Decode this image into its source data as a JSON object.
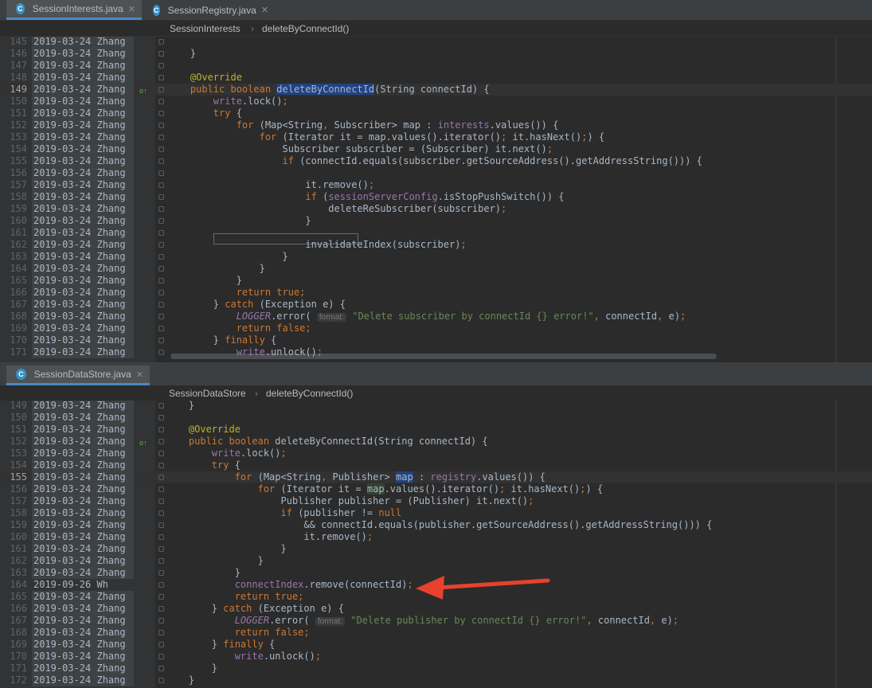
{
  "top": {
    "tabs": [
      {
        "label": "SessionInterests.java",
        "icon": "C",
        "active": true
      },
      {
        "label": "SessionRegistry.java",
        "icon": "C",
        "active": false
      }
    ],
    "breadcrumb": {
      "class": "SessionInterests",
      "method": "deleteByConnectId()"
    },
    "lines": [
      {
        "n": "145",
        "a": "2019-03-24 Zhang",
        "t": []
      },
      {
        "n": "146",
        "a": "2019-03-24 Zhang",
        "t": [
          [
            "    }",
            ""
          ]
        ]
      },
      {
        "n": "147",
        "a": "2019-03-24 Zhang",
        "t": []
      },
      {
        "n": "148",
        "a": "2019-03-24 Zhang",
        "t": [
          [
            "    ",
            ""
          ],
          [
            "@Override",
            "an"
          ]
        ]
      },
      {
        "n": "149",
        "a": "2019-03-24 Zhang",
        "cur": true,
        "t": [
          [
            "    ",
            ""
          ],
          [
            "public boolean ",
            "kw"
          ],
          [
            "deleteByConnectId",
            "sel"
          ],
          [
            "(String connectId) {",
            ""
          ]
        ]
      },
      {
        "n": "150",
        "a": "2019-03-24 Zhang",
        "t": [
          [
            "        ",
            ""
          ],
          [
            "write",
            "fd"
          ],
          [
            ".lock()",
            ""
          ],
          [
            ";",
            "kw"
          ]
        ]
      },
      {
        "n": "151",
        "a": "2019-03-24 Zhang",
        "t": [
          [
            "        ",
            ""
          ],
          [
            "try ",
            "kw"
          ],
          [
            "{",
            ""
          ]
        ]
      },
      {
        "n": "152",
        "a": "2019-03-24 Zhang",
        "t": [
          [
            "            ",
            ""
          ],
          [
            "for ",
            "kw"
          ],
          [
            "(Map<String",
            ""
          ],
          [
            ", ",
            "kw"
          ],
          [
            "Subscriber> map : ",
            ""
          ],
          [
            "interests",
            "fd"
          ],
          [
            ".values()) {",
            ""
          ]
        ]
      },
      {
        "n": "153",
        "a": "2019-03-24 Zhang",
        "t": [
          [
            "                ",
            ""
          ],
          [
            "for ",
            "kw"
          ],
          [
            "(Iterator it = map.values().iterator()",
            ""
          ],
          [
            "; ",
            "kw"
          ],
          [
            "it.hasNext()",
            ""
          ],
          [
            ";",
            "kw"
          ],
          [
            ") {",
            ""
          ]
        ]
      },
      {
        "n": "154",
        "a": "2019-03-24 Zhang",
        "t": [
          [
            "                    Subscriber subscriber = (Subscriber) it.next()",
            ""
          ],
          [
            ";",
            "kw"
          ]
        ]
      },
      {
        "n": "155",
        "a": "2019-03-24 Zhang",
        "t": [
          [
            "                    ",
            ""
          ],
          [
            "if ",
            "kw"
          ],
          [
            "(connectId.equals(subscriber.getSourceAddress().getAddressString())) {",
            ""
          ]
        ]
      },
      {
        "n": "156",
        "a": "2019-03-24 Zhang",
        "t": []
      },
      {
        "n": "157",
        "a": "2019-03-24 Zhang",
        "t": [
          [
            "                        it.remove()",
            ""
          ],
          [
            ";",
            "kw"
          ]
        ]
      },
      {
        "n": "158",
        "a": "2019-03-24 Zhang",
        "t": [
          [
            "                        ",
            ""
          ],
          [
            "if ",
            "kw"
          ],
          [
            "(",
            ""
          ],
          [
            "sessionServerConfig",
            "fd"
          ],
          [
            ".isStopPushSwitch()) {",
            ""
          ]
        ]
      },
      {
        "n": "159",
        "a": "2019-03-24 Zhang",
        "t": [
          [
            "                            deleteReSubscriber(subscriber)",
            ""
          ],
          [
            ";",
            "kw"
          ]
        ]
      },
      {
        "n": "160",
        "a": "2019-03-24 Zhang",
        "t": [
          [
            "                        }",
            ""
          ]
        ]
      },
      {
        "n": "161",
        "a": "2019-03-24 Zhang",
        "t": []
      },
      {
        "n": "162",
        "a": "2019-03-24 Zhang",
        "t": [
          [
            "                        invalidateIndex(subscriber)",
            ""
          ],
          [
            ";",
            "kw"
          ]
        ]
      },
      {
        "n": "163",
        "a": "2019-03-24 Zhang",
        "t": [
          [
            "                    }",
            ""
          ]
        ]
      },
      {
        "n": "164",
        "a": "2019-03-24 Zhang",
        "t": [
          [
            "                }",
            ""
          ]
        ]
      },
      {
        "n": "165",
        "a": "2019-03-24 Zhang",
        "t": [
          [
            "            }",
            ""
          ]
        ]
      },
      {
        "n": "166",
        "a": "2019-03-24 Zhang",
        "t": [
          [
            "            ",
            ""
          ],
          [
            "return true;",
            "kw"
          ]
        ]
      },
      {
        "n": "167",
        "a": "2019-03-24 Zhang",
        "t": [
          [
            "        } ",
            ""
          ],
          [
            "catch ",
            "kw"
          ],
          [
            "(Exception e) {",
            ""
          ]
        ]
      },
      {
        "n": "168",
        "a": "2019-03-24 Zhang",
        "t": [
          [
            "            ",
            ""
          ],
          [
            "LOGGER",
            "mut"
          ],
          [
            ".error( ",
            ""
          ],
          [
            "format:",
            "hint"
          ],
          [
            " ",
            ""
          ],
          [
            "\"Delete subscriber by connectId {} error!\"",
            "st"
          ],
          [
            ", ",
            "kw"
          ],
          [
            "connectId",
            ""
          ],
          [
            ", ",
            "kw"
          ],
          [
            "e)",
            ""
          ],
          [
            ";",
            "kw"
          ]
        ]
      },
      {
        "n": "169",
        "a": "2019-03-24 Zhang",
        "t": [
          [
            "            ",
            ""
          ],
          [
            "return false;",
            "kw"
          ]
        ]
      },
      {
        "n": "170",
        "a": "2019-03-24 Zhang",
        "t": [
          [
            "        } ",
            ""
          ],
          [
            "finally ",
            "kw"
          ],
          [
            "{",
            ""
          ]
        ]
      },
      {
        "n": "171",
        "a": "2019-03-24 Zhang",
        "t": [
          [
            "            ",
            ""
          ],
          [
            "write",
            "fd"
          ],
          [
            ".unlock()",
            ""
          ],
          [
            ";",
            "kw"
          ]
        ]
      }
    ]
  },
  "bottom": {
    "tabs": [
      {
        "label": "SessionDataStore.java",
        "icon": "C",
        "active": true
      }
    ],
    "breadcrumb": {
      "class": "SessionDataStore",
      "method": "deleteByConnectId()"
    },
    "lines": [
      {
        "n": "149",
        "a": "2019-03-24 Zhang",
        "t": [
          [
            "    }",
            ""
          ]
        ]
      },
      {
        "n": "150",
        "a": "2019-03-24 Zhang",
        "t": []
      },
      {
        "n": "151",
        "a": "2019-03-24 Zhang",
        "t": [
          [
            "    ",
            ""
          ],
          [
            "@Override",
            "an"
          ]
        ]
      },
      {
        "n": "152",
        "a": "2019-03-24 Zhang",
        "t": [
          [
            "    ",
            ""
          ],
          [
            "public boolean ",
            "kw"
          ],
          [
            "deleteByConnectId",
            "plain"
          ],
          [
            "(String connectId) {",
            ""
          ]
        ]
      },
      {
        "n": "153",
        "a": "2019-03-24 Zhang",
        "t": [
          [
            "        ",
            ""
          ],
          [
            "write",
            "fd"
          ],
          [
            ".lock()",
            ""
          ],
          [
            ";",
            "kw"
          ]
        ]
      },
      {
        "n": "154",
        "a": "2019-03-24 Zhang",
        "t": [
          [
            "        ",
            ""
          ],
          [
            "try ",
            "kw"
          ],
          [
            "{",
            ""
          ]
        ]
      },
      {
        "n": "155",
        "a": "2019-03-24 Zhang",
        "cur": true,
        "t": [
          [
            "            ",
            ""
          ],
          [
            "for ",
            "kw"
          ],
          [
            "(Map<String",
            ""
          ],
          [
            ", ",
            "kw"
          ],
          [
            "Publisher> ",
            ""
          ],
          [
            "map",
            "sel"
          ],
          [
            " : ",
            ""
          ],
          [
            "registry",
            "fd"
          ],
          [
            ".values()) {",
            ""
          ]
        ]
      },
      {
        "n": "156",
        "a": "2019-03-24 Zhang",
        "t": [
          [
            "                ",
            ""
          ],
          [
            "for ",
            "kw"
          ],
          [
            "(Iterator it = ",
            ""
          ],
          [
            "map",
            "ident"
          ],
          [
            ".values().iterator()",
            ""
          ],
          [
            "; ",
            "kw"
          ],
          [
            "it.hasNext()",
            ""
          ],
          [
            ";",
            "kw"
          ],
          [
            ") {",
            ""
          ]
        ]
      },
      {
        "n": "157",
        "a": "2019-03-24 Zhang",
        "t": [
          [
            "                    Publisher publisher = (Publisher) it.next()",
            ""
          ],
          [
            ";",
            "kw"
          ]
        ]
      },
      {
        "n": "158",
        "a": "2019-03-24 Zhang",
        "t": [
          [
            "                    ",
            ""
          ],
          [
            "if ",
            "kw"
          ],
          [
            "(publisher != ",
            ""
          ],
          [
            "null",
            "kw"
          ]
        ]
      },
      {
        "n": "159",
        "a": "2019-03-24 Zhang",
        "t": [
          [
            "                        && connectId.equals(publisher.getSourceAddress().getAddressString())) {",
            ""
          ]
        ]
      },
      {
        "n": "160",
        "a": "2019-03-24 Zhang",
        "t": [
          [
            "                        it.remove()",
            ""
          ],
          [
            ";",
            "kw"
          ]
        ]
      },
      {
        "n": "161",
        "a": "2019-03-24 Zhang",
        "t": [
          [
            "                    }",
            ""
          ]
        ]
      },
      {
        "n": "162",
        "a": "2019-03-24 Zhang",
        "t": [
          [
            "                }",
            ""
          ]
        ]
      },
      {
        "n": "163",
        "a": "2019-03-24 Zhang",
        "t": [
          [
            "            }",
            ""
          ]
        ]
      },
      {
        "n": "164",
        "a": "2019-09-26 Wh",
        "wh": true,
        "t": [
          [
            "            ",
            ""
          ],
          [
            "connectIndex",
            "fd"
          ],
          [
            ".remove(connectId)",
            ""
          ],
          [
            ";",
            "kw"
          ]
        ]
      },
      {
        "n": "165",
        "a": "2019-03-24 Zhang",
        "t": [
          [
            "            ",
            ""
          ],
          [
            "return true;",
            "kw"
          ]
        ]
      },
      {
        "n": "166",
        "a": "2019-03-24 Zhang",
        "t": [
          [
            "        } ",
            ""
          ],
          [
            "catch ",
            "kw"
          ],
          [
            "(Exception e) {",
            ""
          ]
        ]
      },
      {
        "n": "167",
        "a": "2019-03-24 Zhang",
        "t": [
          [
            "            ",
            ""
          ],
          [
            "LOGGER",
            "mut"
          ],
          [
            ".error( ",
            ""
          ],
          [
            "format:",
            "hint"
          ],
          [
            " ",
            ""
          ],
          [
            "\"Delete publisher by connectId {} error!\"",
            "st"
          ],
          [
            ", ",
            "kw"
          ],
          [
            "connectId",
            ""
          ],
          [
            ", ",
            "kw"
          ],
          [
            "e)",
            ""
          ],
          [
            ";",
            "kw"
          ]
        ]
      },
      {
        "n": "168",
        "a": "2019-03-24 Zhang",
        "t": [
          [
            "            ",
            ""
          ],
          [
            "return false;",
            "kw"
          ]
        ]
      },
      {
        "n": "169",
        "a": "2019-03-24 Zhang",
        "t": [
          [
            "        } ",
            ""
          ],
          [
            "finally ",
            "kw"
          ],
          [
            "{",
            ""
          ]
        ]
      },
      {
        "n": "170",
        "a": "2019-03-24 Zhang",
        "t": [
          [
            "            ",
            ""
          ],
          [
            "write",
            "fd"
          ],
          [
            ".unlock()",
            ""
          ],
          [
            ";",
            "kw"
          ]
        ]
      },
      {
        "n": "171",
        "a": "2019-03-24 Zhang",
        "t": [
          [
            "        }",
            ""
          ]
        ]
      },
      {
        "n": "172",
        "a": "2019-03-24 Zhang",
        "t": [
          [
            "    }",
            ""
          ]
        ]
      }
    ]
  },
  "colors": {
    "keyword": "#cc7832",
    "annotation": "#bbb529",
    "field": "#9876aa",
    "string": "#6a8759",
    "text": "#a9b7c6",
    "arrow": "#e8412c"
  }
}
